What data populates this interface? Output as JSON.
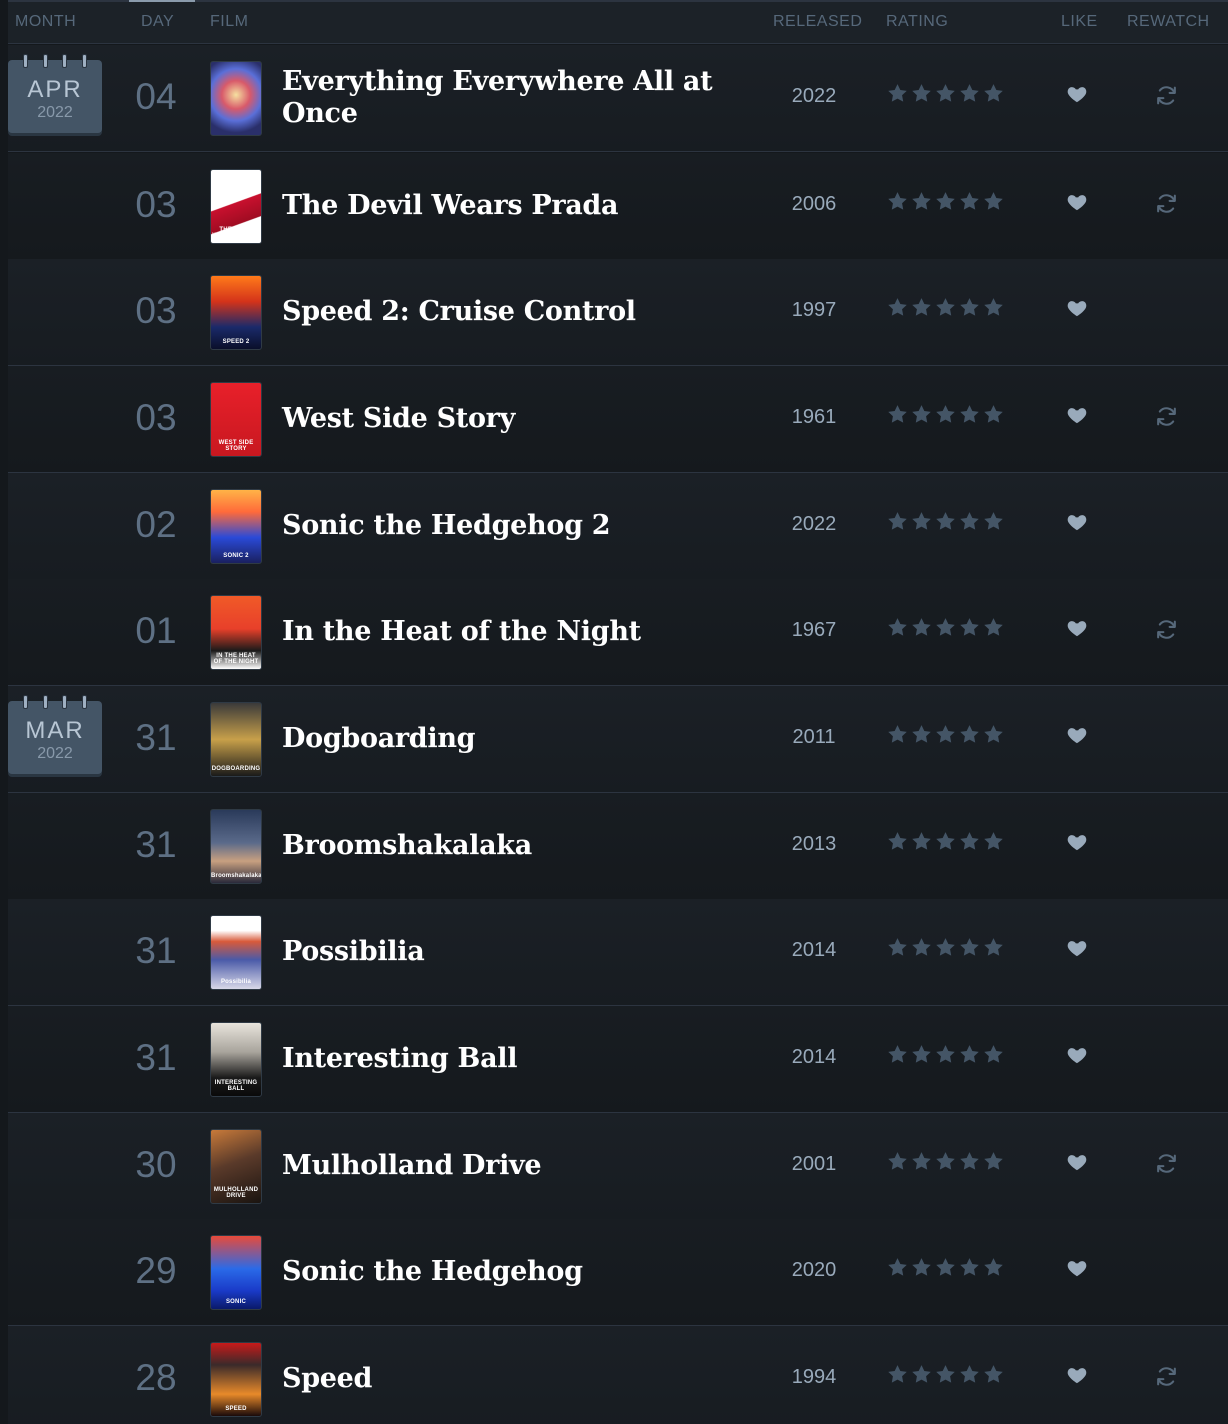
{
  "columns": {
    "month": "MONTH",
    "day": "DAY",
    "film": "FILM",
    "released": "RELEASED",
    "rating": "RATING",
    "like": "LIKE",
    "rewatch": "REWATCH"
  },
  "colors": {
    "background": "#14181c",
    "star": "#445566",
    "heart": "#99aabb",
    "calendar": "#445566"
  },
  "entries": [
    {
      "month": "APR",
      "year": "2022",
      "day": "04",
      "title": "Everything Everywhere All at Once",
      "released": "2022",
      "stars": 5,
      "liked": true,
      "rewatch": true,
      "poster_text": ""
    },
    {
      "month": "",
      "year": "",
      "day": "03",
      "title": "The Devil Wears Prada",
      "released": "2006",
      "stars": 5,
      "liked": true,
      "rewatch": true,
      "poster_text": "THE DEVIL WEARS PRADA"
    },
    {
      "month": "",
      "year": "",
      "day": "03",
      "title": "Speed 2: Cruise Control",
      "released": "1997",
      "stars": 5,
      "liked": true,
      "rewatch": false,
      "poster_text": "SPEED 2"
    },
    {
      "month": "",
      "year": "",
      "day": "03",
      "title": "West Side Story",
      "released": "1961",
      "stars": 5,
      "liked": true,
      "rewatch": true,
      "poster_text": "WEST SIDE STORY"
    },
    {
      "month": "",
      "year": "",
      "day": "02",
      "title": "Sonic the Hedgehog 2",
      "released": "2022",
      "stars": 5,
      "liked": true,
      "rewatch": false,
      "poster_text": "SONIC 2"
    },
    {
      "month": "",
      "year": "",
      "day": "01",
      "title": "In the Heat of the Night",
      "released": "1967",
      "stars": 5,
      "liked": true,
      "rewatch": true,
      "poster_text": "IN THE HEAT OF THE NIGHT"
    },
    {
      "month": "MAR",
      "year": "2022",
      "day": "31",
      "title": "Dogboarding",
      "released": "2011",
      "stars": 5,
      "liked": true,
      "rewatch": false,
      "poster_text": "DOGBOARDING"
    },
    {
      "month": "",
      "year": "",
      "day": "31",
      "title": "Broomshakalaka",
      "released": "2013",
      "stars": 5,
      "liked": true,
      "rewatch": false,
      "poster_text": "Broomshakalaka"
    },
    {
      "month": "",
      "year": "",
      "day": "31",
      "title": "Possibilia",
      "released": "2014",
      "stars": 5,
      "liked": true,
      "rewatch": false,
      "poster_text": "Possibilia"
    },
    {
      "month": "",
      "year": "",
      "day": "31",
      "title": "Interesting Ball",
      "released": "2014",
      "stars": 5,
      "liked": true,
      "rewatch": false,
      "poster_text": "INTERESTING BALL"
    },
    {
      "month": "",
      "year": "",
      "day": "30",
      "title": "Mulholland Drive",
      "released": "2001",
      "stars": 5,
      "liked": true,
      "rewatch": true,
      "poster_text": "MULHOLLAND DRIVE"
    },
    {
      "month": "",
      "year": "",
      "day": "29",
      "title": "Sonic the Hedgehog",
      "released": "2020",
      "stars": 5,
      "liked": true,
      "rewatch": false,
      "poster_text": "SONIC"
    },
    {
      "month": "",
      "year": "",
      "day": "28",
      "title": "Speed",
      "released": "1994",
      "stars": 5,
      "liked": true,
      "rewatch": true,
      "poster_text": "SPEED"
    }
  ]
}
